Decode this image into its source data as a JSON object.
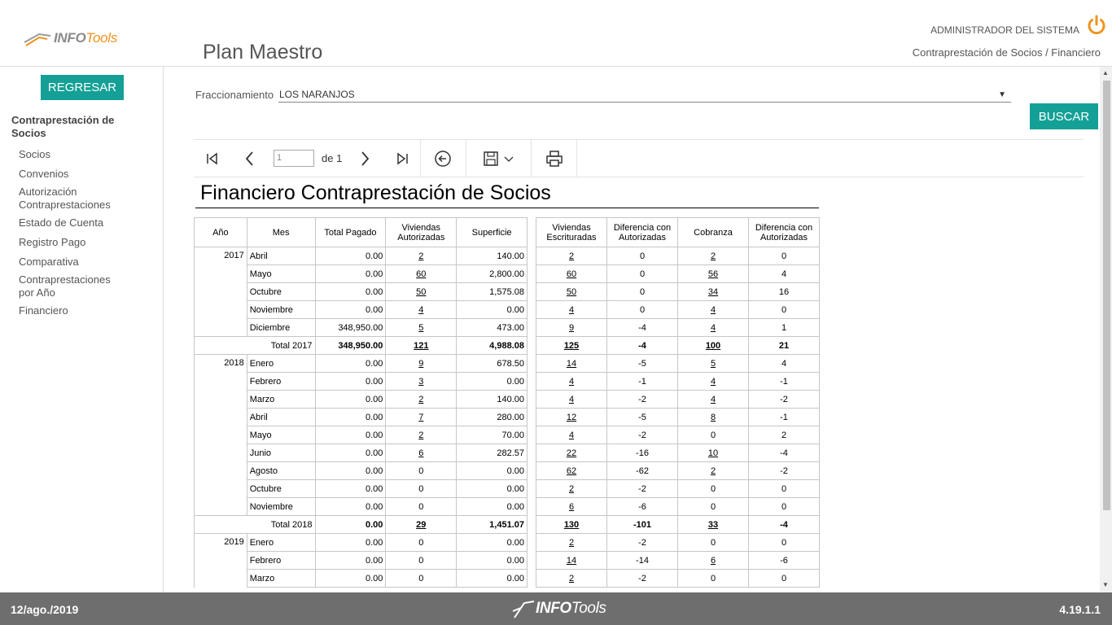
{
  "header": {
    "logo_info": "INFO",
    "logo_tools": "Tools",
    "page_title": "Plan Maestro",
    "user": "ADMINISTRADOR DEL SISTEMA",
    "breadcrumb": "Contraprestación de Socios / Financiero",
    "accent": "#f0931f"
  },
  "sidebar": {
    "back_label": "REGRESAR",
    "section": "Contraprestación de Socios",
    "items": [
      "Socios",
      "Convenios",
      "Autorización Contraprestaciones",
      "Estado de Cuenta",
      "Registro Pago",
      "Comparativa",
      "Contraprestaciones por Año",
      "Financiero"
    ]
  },
  "filter": {
    "label": "Fraccionamiento",
    "value": "LOS NARANJOS",
    "search_label": "BUSCAR"
  },
  "toolbar": {
    "page_value": "1",
    "page_of": "de 1"
  },
  "report": {
    "title": "Financiero Contraprestación de Socios",
    "headers_left": [
      "Año",
      "Mes",
      "Total Pagado",
      "Viviendas Autorizadas",
      "Superficie"
    ],
    "headers_right": [
      "Viviendas Escrituradas",
      "Diferencia con Autorizadas",
      "Cobranza",
      "Diferencia con Autorizadas"
    ],
    "rows": [
      {
        "year": "2017",
        "mes": "Abril",
        "pagado": "0.00",
        "aut": "2",
        "sup": "140.00",
        "esc": "2",
        "dif1": "0",
        "cob": "2",
        "dif2": "0"
      },
      {
        "year": "",
        "mes": "Mayo",
        "pagado": "0.00",
        "aut": "60",
        "sup": "2,800.00",
        "esc": "60",
        "dif1": "0",
        "cob": "56",
        "dif2": "4"
      },
      {
        "year": "",
        "mes": "Octubre",
        "pagado": "0.00",
        "aut": "50",
        "sup": "1,575.08",
        "esc": "50",
        "dif1": "0",
        "cob": "34",
        "dif2": "16"
      },
      {
        "year": "",
        "mes": "Noviembre",
        "pagado": "0.00",
        "aut": "4",
        "sup": "0.00",
        "esc": "4",
        "dif1": "0",
        "cob": "4",
        "dif2": "0"
      },
      {
        "year": "",
        "mes": "Diciembre",
        "pagado": "348,950.00",
        "aut": "5",
        "sup": "473.00",
        "esc": "9",
        "dif1": "-4",
        "cob": "4",
        "dif2": "1"
      },
      {
        "total": "Total 2017",
        "pagado": "348,950.00",
        "aut": "121",
        "sup": "4,988.08",
        "esc": "125",
        "dif1": "-4",
        "cob": "100",
        "dif2": "21"
      },
      {
        "year": "2018",
        "mes": "Enero",
        "pagado": "0.00",
        "aut": "9",
        "sup": "678.50",
        "esc": "14",
        "dif1": "-5",
        "cob": "5",
        "dif2": "4"
      },
      {
        "year": "",
        "mes": "Febrero",
        "pagado": "0.00",
        "aut": "3",
        "sup": "0.00",
        "esc": "4",
        "dif1": "-1",
        "cob": "4",
        "dif2": "-1"
      },
      {
        "year": "",
        "mes": "Marzo",
        "pagado": "0.00",
        "aut": "2",
        "sup": "140.00",
        "esc": "4",
        "dif1": "-2",
        "cob": "4",
        "dif2": "-2"
      },
      {
        "year": "",
        "mes": "Abril",
        "pagado": "0.00",
        "aut": "7",
        "sup": "280.00",
        "esc": "12",
        "dif1": "-5",
        "cob": "8",
        "dif2": "-1"
      },
      {
        "year": "",
        "mes": "Mayo",
        "pagado": "0.00",
        "aut": "2",
        "sup": "70.00",
        "esc": "4",
        "dif1": "-2",
        "cob": "0",
        "dif2": "2"
      },
      {
        "year": "",
        "mes": "Junio",
        "pagado": "0.00",
        "aut": "6",
        "sup": "282.57",
        "esc": "22",
        "dif1": "-16",
        "cob": "10",
        "dif2": "-4"
      },
      {
        "year": "",
        "mes": "Agosto",
        "pagado": "0.00",
        "aut": "0",
        "sup": "0.00",
        "esc": "62",
        "dif1": "-62",
        "cob": "2",
        "dif2": "-2"
      },
      {
        "year": "",
        "mes": "Octubre",
        "pagado": "0.00",
        "aut": "0",
        "sup": "0.00",
        "esc": "2",
        "dif1": "-2",
        "cob": "0",
        "dif2": "0"
      },
      {
        "year": "",
        "mes": "Noviembre",
        "pagado": "0.00",
        "aut": "0",
        "sup": "0.00",
        "esc": "6",
        "dif1": "-6",
        "cob": "0",
        "dif2": "0"
      },
      {
        "total": "Total 2018",
        "pagado": "0.00",
        "aut": "29",
        "sup": "1,451.07",
        "esc": "130",
        "dif1": "-101",
        "cob": "33",
        "dif2": "-4"
      },
      {
        "year": "2019",
        "mes": "Enero",
        "pagado": "0.00",
        "aut": "0",
        "sup": "0.00",
        "esc": "2",
        "dif1": "-2",
        "cob": "0",
        "dif2": "0"
      },
      {
        "year": "",
        "mes": "Febrero",
        "pagado": "0.00",
        "aut": "0",
        "sup": "0.00",
        "esc": "14",
        "dif1": "-14",
        "cob": "6",
        "dif2": "-6"
      },
      {
        "year": "",
        "mes": "Marzo",
        "pagado": "0.00",
        "aut": "0",
        "sup": "0.00",
        "esc": "2",
        "dif1": "-2",
        "cob": "0",
        "dif2": "0"
      }
    ]
  },
  "footer": {
    "date": "12/ago./2019",
    "logo_info": "INFO",
    "logo_tools": "Tools",
    "version": "4.19.1.1"
  }
}
